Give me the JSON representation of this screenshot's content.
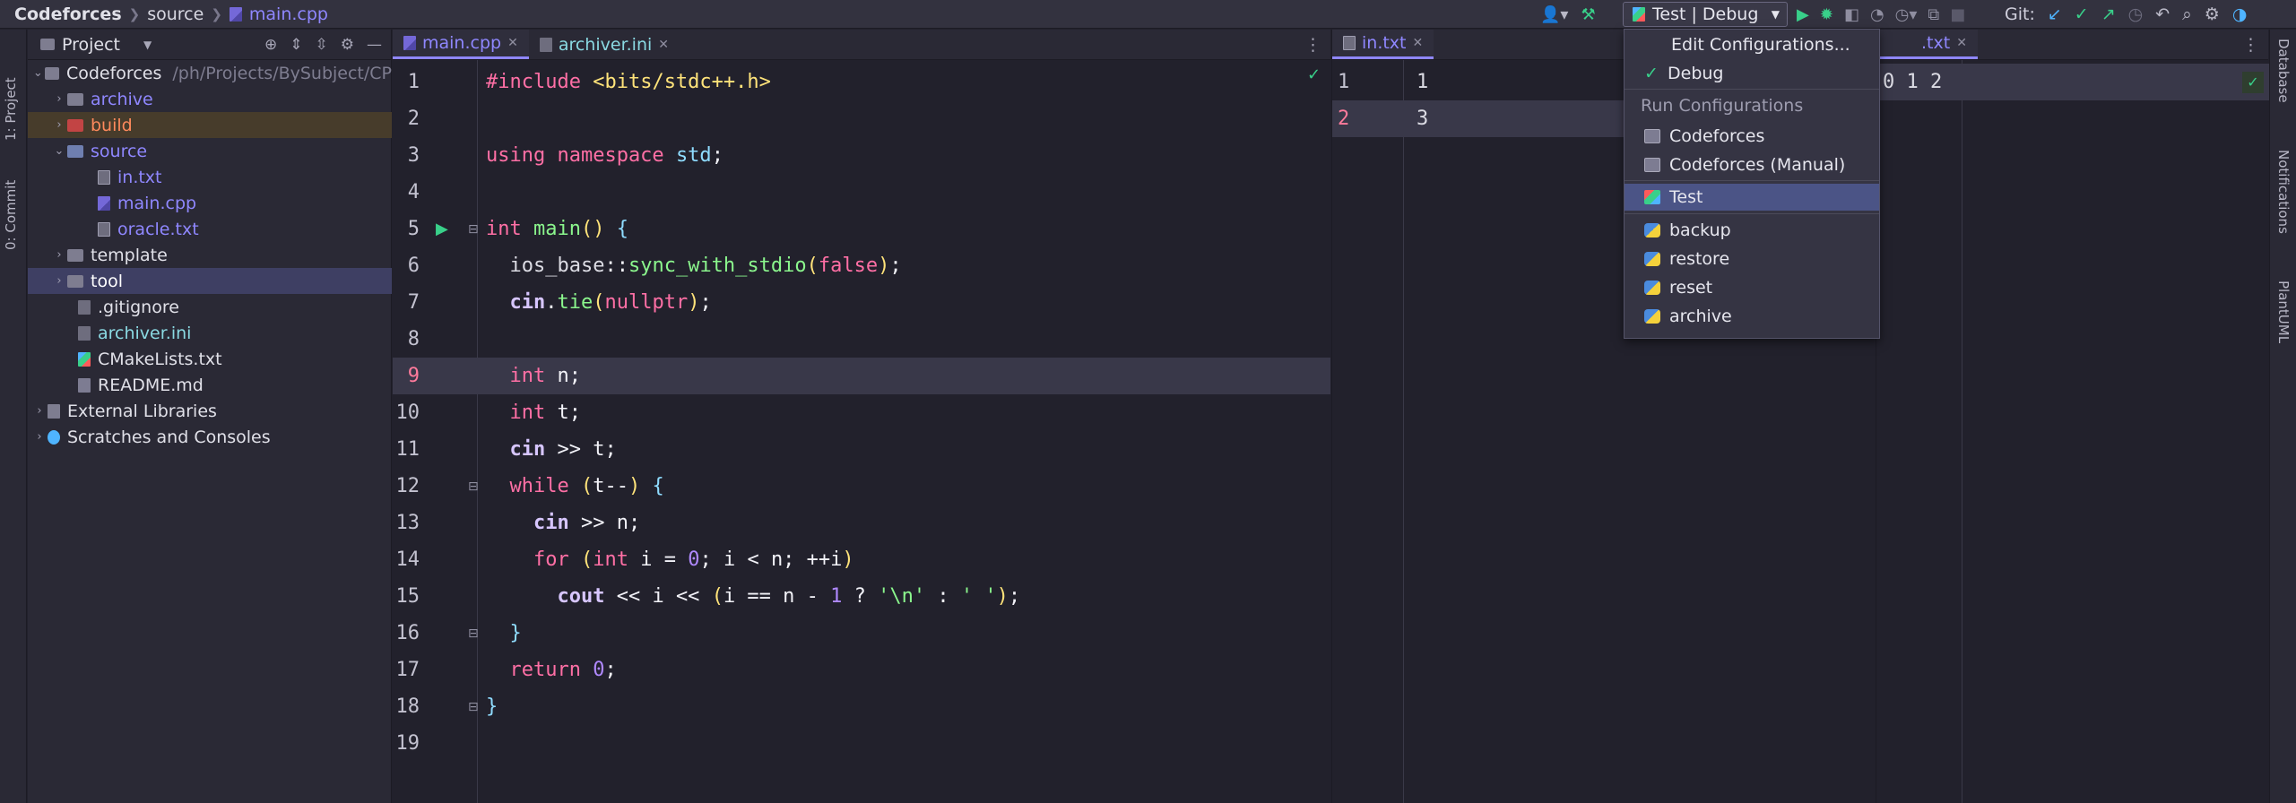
{
  "breadcrumb": [
    "Codeforces",
    "source",
    "main.cpp"
  ],
  "toolbar": {
    "run_config_label": "Test | Debug",
    "git_label": "Git:"
  },
  "left_strip": {
    "project_tab": "1: Project",
    "commit_tab": "0: Commit"
  },
  "right_strip": {
    "database_tab": "Database",
    "notifications_tab": "Notifications",
    "plantuml_tab": "PlantUML"
  },
  "project": {
    "title": "Project",
    "tree": [
      {
        "label": "Codeforces",
        "path": "/ph/Projects/BySubject/CP",
        "color": "#e0e0e8"
      },
      {
        "label": "archive",
        "color": "#8f87ff"
      },
      {
        "label": "build",
        "color": "#ff8a5c"
      },
      {
        "label": "source",
        "color": "#8f87ff"
      },
      {
        "label": "in.txt",
        "color": "#8f87ff"
      },
      {
        "label": "main.cpp",
        "color": "#8f87ff"
      },
      {
        "label": "oracle.txt",
        "color": "#8f87ff"
      },
      {
        "label": "template",
        "color": "#e0e0e8"
      },
      {
        "label": "tool",
        "color": "#ffffff"
      },
      {
        "label": ".gitignore",
        "color": "#e0e0e8"
      },
      {
        "label": "archiver.ini",
        "color": "#8ad9e2"
      },
      {
        "label": "CMakeLists.txt",
        "color": "#e0e0e8"
      },
      {
        "label": "README.md",
        "color": "#e0e0e8"
      },
      {
        "label": "External Libraries",
        "color": "#e0e0e8"
      },
      {
        "label": "Scratches and Consoles",
        "color": "#e0e0e8"
      }
    ]
  },
  "editor": {
    "tabs": [
      "main.cpp",
      "archiver.ini"
    ],
    "line_numbers": [
      "1",
      "2",
      "3",
      "4",
      "5",
      "6",
      "7",
      "8",
      "9",
      "10",
      "11",
      "12",
      "13",
      "14",
      "15",
      "16",
      "17",
      "18",
      "19"
    ]
  },
  "in_pane": {
    "tab": "in.txt",
    "line_numbers": [
      "1",
      "2"
    ],
    "lines": [
      "1",
      "3"
    ]
  },
  "out_pane": {
    "tab": ".txt",
    "line": "0 1 2"
  },
  "popup": {
    "edit_configurations": "Edit Configurations...",
    "debug": "Debug",
    "section_title": "Run Configurations",
    "items": [
      "Codeforces",
      "Codeforces (Manual)",
      "Test",
      "backup",
      "restore",
      "reset",
      "archive"
    ]
  }
}
